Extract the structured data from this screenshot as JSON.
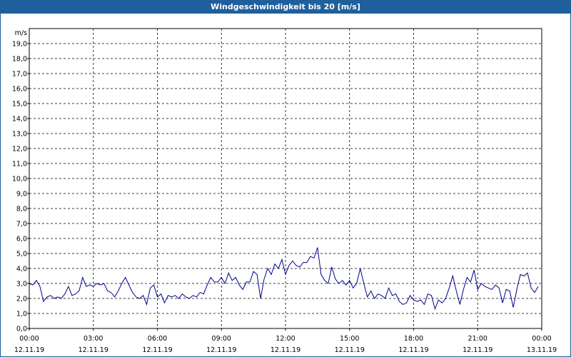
{
  "window": {
    "title": "Windgeschwindigkeit bis 20 [m/s]"
  },
  "chart_data": {
    "type": "line",
    "title": "Windgeschwindigkeit bis 20 [m/s]",
    "ylabel": "m/s",
    "ylim": [
      0,
      20
    ],
    "yticks": [
      "0,0",
      "1,0",
      "2,0",
      "3,0",
      "4,0",
      "5,0",
      "6,0",
      "7,0",
      "8,0",
      "9,0",
      "10,0",
      "11,0",
      "12,0",
      "13,0",
      "14,0",
      "15,0",
      "16,0",
      "17,0",
      "18,0",
      "19,0"
    ],
    "xlim": [
      "2019-11-12 00:00",
      "2019-11-13 00:00"
    ],
    "xticks": [
      {
        "time": "00:00",
        "date": "12.11.19"
      },
      {
        "time": "03:00",
        "date": "12.11.19"
      },
      {
        "time": "06:00",
        "date": "12.11.19"
      },
      {
        "time": "09:00",
        "date": "12.11.19"
      },
      {
        "time": "12:00",
        "date": "12.11.19"
      },
      {
        "time": "15:00",
        "date": "12.11.19"
      },
      {
        "time": "18:00",
        "date": "12.11.19"
      },
      {
        "time": "21:00",
        "date": "12.11.19"
      },
      {
        "time": "00:00",
        "date": "13.11.19"
      }
    ],
    "grid": true,
    "line_color": "#00008b",
    "series": [
      {
        "x": [
          "00:00",
          "00:10",
          "00:20",
          "00:30",
          "00:40",
          "00:50",
          "01:00",
          "01:10",
          "01:20",
          "01:30",
          "01:40",
          "01:50",
          "02:00",
          "02:10",
          "02:20",
          "02:30",
          "02:40",
          "02:50",
          "03:00",
          "03:10",
          "03:20",
          "03:30",
          "03:40",
          "03:50",
          "04:00",
          "04:10",
          "04:20",
          "04:30",
          "04:40",
          "04:50",
          "05:00",
          "05:10",
          "05:20",
          "05:30",
          "05:40",
          "05:50",
          "06:00",
          "06:10",
          "06:20",
          "06:30",
          "06:40",
          "06:50",
          "07:00",
          "07:10",
          "07:20",
          "07:30",
          "07:40",
          "07:50",
          "08:00",
          "08:10",
          "08:20",
          "08:30",
          "08:40",
          "08:50",
          "09:00",
          "09:10",
          "09:20",
          "09:30",
          "09:40",
          "09:50",
          "10:00",
          "10:10",
          "10:20",
          "10:30",
          "10:40",
          "10:50",
          "11:00",
          "11:10",
          "11:20",
          "11:30",
          "11:40",
          "11:50",
          "12:00",
          "12:10",
          "12:20",
          "12:30",
          "12:40",
          "12:50",
          "13:00",
          "13:10",
          "13:20",
          "13:30",
          "13:40",
          "13:50",
          "14:00",
          "14:10",
          "14:20",
          "14:30",
          "14:40",
          "14:50",
          "15:00",
          "15:10",
          "15:20",
          "15:30",
          "15:40",
          "15:50",
          "16:00",
          "16:10",
          "16:20",
          "16:30",
          "16:40",
          "16:50",
          "17:00",
          "17:10",
          "17:20",
          "17:30",
          "17:40",
          "17:50",
          "18:00",
          "18:10",
          "18:20",
          "18:30",
          "18:40",
          "18:50",
          "19:00",
          "19:10",
          "19:20",
          "19:30",
          "19:40",
          "19:50",
          "20:00",
          "20:10",
          "20:20",
          "20:30",
          "20:40",
          "20:50",
          "21:00",
          "21:10",
          "21:20",
          "21:30",
          "21:40",
          "21:50",
          "22:00",
          "22:10",
          "22:20",
          "22:30",
          "22:40",
          "22:50",
          "23:00",
          "23:10",
          "23:20",
          "23:30",
          "23:40",
          "23:50"
        ],
        "values": [
          3.0,
          2.9,
          3.2,
          2.8,
          1.8,
          2.1,
          2.2,
          2.0,
          2.1,
          2.0,
          2.3,
          2.8,
          2.2,
          2.3,
          2.5,
          3.4,
          2.8,
          2.9,
          2.8,
          3.0,
          2.9,
          3.0,
          2.5,
          2.4,
          2.1,
          2.5,
          3.0,
          3.4,
          2.9,
          2.4,
          2.1,
          2.0,
          2.2,
          1.6,
          2.7,
          2.9,
          2.1,
          2.3,
          1.7,
          2.2,
          2.1,
          2.2,
          2.0,
          2.3,
          2.1,
          2.0,
          2.2,
          2.1,
          2.4,
          2.3,
          2.9,
          3.4,
          3.1,
          3.1,
          3.4,
          3.0,
          3.7,
          3.2,
          3.4,
          2.9,
          2.6,
          3.1,
          3.1,
          3.8,
          3.6,
          2.0,
          3.3,
          4.0,
          3.6,
          4.3,
          4.0,
          4.6,
          3.6,
          4.2,
          4.5,
          4.2,
          4.1,
          4.4,
          4.4,
          4.8,
          4.7,
          5.4,
          3.6,
          3.2,
          3.0,
          4.1,
          3.3,
          3.0,
          3.2,
          2.9,
          3.2,
          2.7,
          3.0,
          4.0,
          3.0,
          2.1,
          2.5,
          2.0,
          2.3,
          2.2,
          2.0,
          2.7,
          2.2,
          2.3,
          1.8,
          1.6,
          1.7,
          2.2,
          1.9,
          1.8,
          1.9,
          1.6,
          2.3,
          2.2,
          1.3,
          1.9,
          1.7,
          2.0,
          2.7,
          3.5,
          2.5,
          1.6,
          2.6,
          3.4,
          3.1,
          3.9,
          2.6,
          3.0,
          2.8,
          2.7,
          2.6,
          2.9,
          2.7,
          1.7,
          2.6,
          2.5,
          1.4,
          2.6,
          3.6,
          3.5,
          3.7,
          2.7,
          2.4,
          2.8
        ]
      }
    ]
  }
}
